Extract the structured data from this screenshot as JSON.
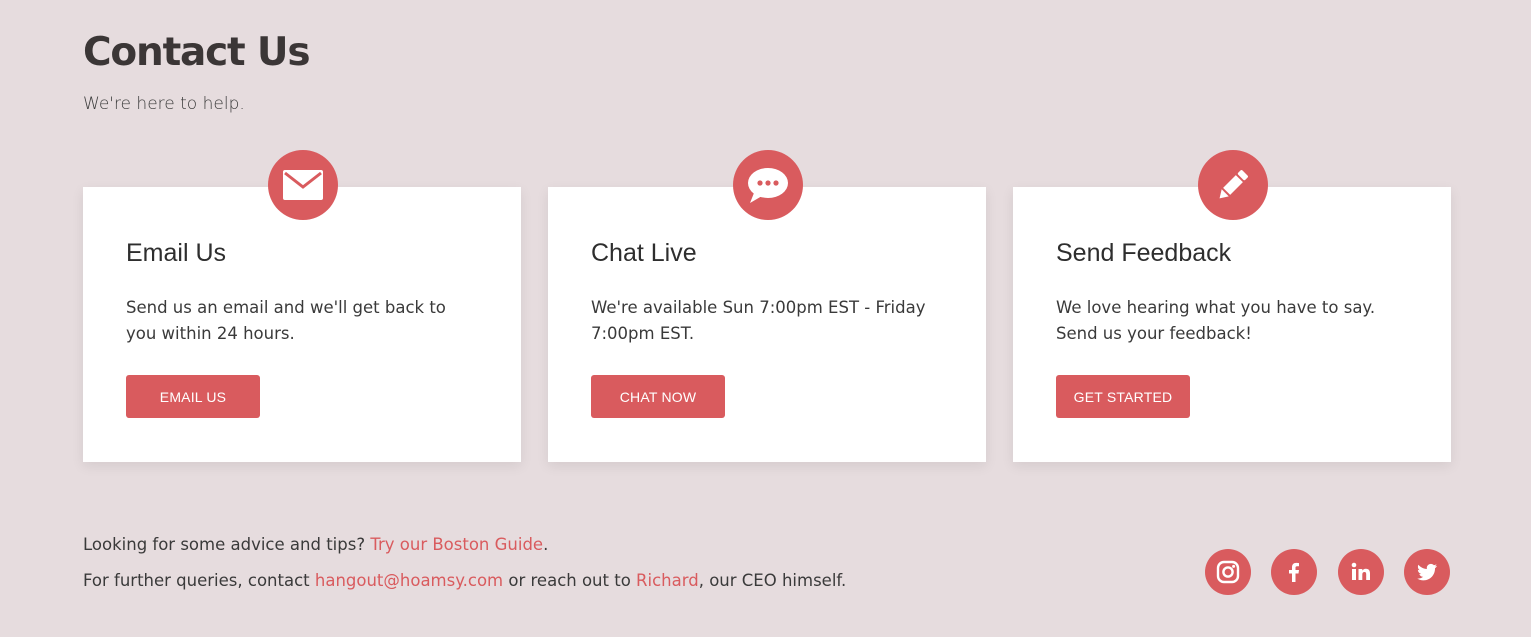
{
  "header": {
    "title": "Contact Us",
    "subtitle": "We're here to help."
  },
  "cards": [
    {
      "icon": "envelope-icon",
      "title": "Email Us",
      "text": "Send us an email and we'll get back to you within 24 hours.",
      "button": "EMAIL US"
    },
    {
      "icon": "chat-bubble-icon",
      "title": "Chat Live",
      "text": "We're available Sun 7:00pm EST - Friday 7:00pm EST.",
      "button": "CHAT NOW"
    },
    {
      "icon": "pencil-icon",
      "title": "Send Feedback",
      "text": "We love hearing what you have to say. Send us your feedback!",
      "button": "GET STARTED"
    }
  ],
  "footer": {
    "line1_prefix": "Looking for some advice and tips? ",
    "line1_link": "Try our Boston Guide",
    "line1_suffix": ".",
    "line2_prefix": "For further queries, contact ",
    "line2_email": "hangout@hoamsy.com",
    "line2_middle": " or reach out to ",
    "line2_name": "Richard",
    "line2_suffix": ", our CEO himself."
  },
  "social": [
    {
      "icon": "instagram-icon"
    },
    {
      "icon": "facebook-icon"
    },
    {
      "icon": "linkedin-icon"
    },
    {
      "icon": "twitter-icon"
    }
  ],
  "colors": {
    "background": "#e6dcde",
    "accent": "#d95b5e",
    "card": "#ffffff",
    "text": "#3a3a3a"
  }
}
